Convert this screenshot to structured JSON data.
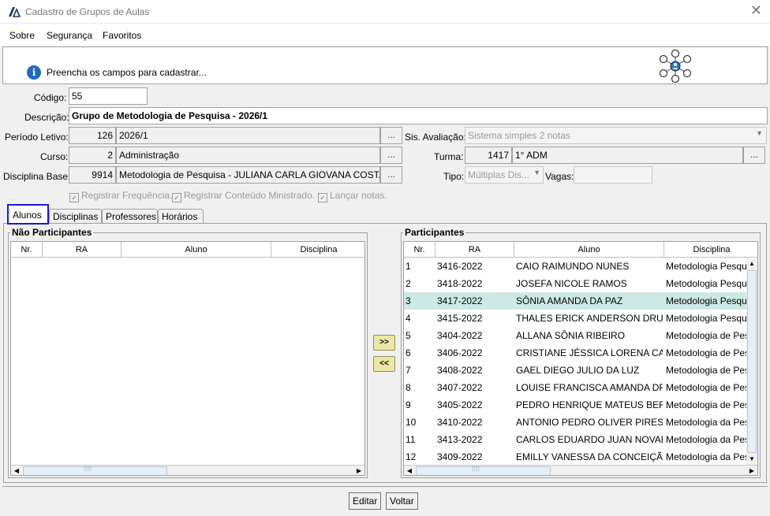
{
  "window": {
    "title": "Cadastro de Grupos de Aulas",
    "close_glyph": "✕"
  },
  "menu": [
    {
      "label": "Sobre"
    },
    {
      "label": "Segurança"
    },
    {
      "label": "Favoritos"
    }
  ],
  "info": {
    "icon_letter": "i",
    "message": "Preencha os campos para cadastrar..."
  },
  "form": {
    "codigo_label": "Código:",
    "codigo_value": "55",
    "descricao_label": "Descrição:",
    "descricao_value": "Grupo de Metodologia de Pesquisa - 2026/1",
    "periodo_label": "Período Letivo:",
    "periodo_code": "126",
    "periodo_value": "2026/1",
    "sis_avaliacao_label": "Sis. Avaliação:",
    "sis_avaliacao_value": "Sistema simples 2 notas",
    "curso_label": "Curso:",
    "curso_code": "2",
    "curso_value": "Administração",
    "turma_label": "Turma:",
    "turma_code": "1417",
    "turma_value": "1° ADM",
    "disciplina_label": "Disciplina Base:",
    "disciplina_code": "9914",
    "disciplina_value": "Metodologia de Pesquisa - JULIANA CARLA GIOVANA COSTA",
    "tipo_label": "Tipo:",
    "tipo_value": "Múltiplas Dis...",
    "vagas_label": "Vagas:",
    "vagas_value": "",
    "ellipsis": "...",
    "check_frequencia": "Registrar Frequência.",
    "check_conteudo": "Registrar Conteúdo Ministrado.",
    "check_notas": "Lançar notas.",
    "check_mark": "✓"
  },
  "tabs": [
    {
      "label": "Alunos"
    },
    {
      "label": "Disciplinas"
    },
    {
      "label": "Professores"
    },
    {
      "label": "Horários"
    }
  ],
  "nao_participantes": {
    "title": "Não Participantes",
    "columns": [
      "Nr.",
      "RA",
      "Aluno",
      "Disciplina"
    ]
  },
  "participantes": {
    "title": "Participantes",
    "columns": [
      "Nr.",
      "RA",
      "Aluno",
      "Disciplina"
    ],
    "rows": [
      {
        "nr": "1",
        "ra": "3416-2022",
        "aluno": "CAIO RAIMUNDO NUNES",
        "disciplina": "Metodologia Pesqu"
      },
      {
        "nr": "2",
        "ra": "3418-2022",
        "aluno": "JOSEFA NICOLE RAMOS",
        "disciplina": "Metodologia Pesqu"
      },
      {
        "nr": "3",
        "ra": "3417-2022",
        "aluno": "SÔNIA AMANDA DA PAZ",
        "disciplina": "Metodologia Pesqu"
      },
      {
        "nr": "4",
        "ra": "3415-2022",
        "aluno": "THALES ERICK ANDERSON DRUM...",
        "disciplina": "Metodologia Pesqu"
      },
      {
        "nr": "5",
        "ra": "3404-2022",
        "aluno": "ALLANA SÔNIA RIBEIRO",
        "disciplina": "Metodologia de Pes"
      },
      {
        "nr": "6",
        "ra": "3406-2022",
        "aluno": "CRISTIANE JÉSSICA LORENA CAM...",
        "disciplina": "Metodologia de Pes"
      },
      {
        "nr": "7",
        "ra": "3408-2022",
        "aluno": "GAEL DIEGO JULIO DA LUZ",
        "disciplina": "Metodologia de Pes"
      },
      {
        "nr": "8",
        "ra": "3407-2022",
        "aluno": "LOUISE FRANCISCA AMANDA DR...",
        "disciplina": "Metodologia de Pes"
      },
      {
        "nr": "9",
        "ra": "3405-2022",
        "aluno": "PEDRO HENRIQUE MATEUS BERN...",
        "disciplina": "Metodologia de Pes"
      },
      {
        "nr": "10",
        "ra": "3410-2022",
        "aluno": "ANTONIO PEDRO OLIVER PIRES",
        "disciplina": "Metodologia da Pes"
      },
      {
        "nr": "11",
        "ra": "3413-2022",
        "aluno": "CARLOS EDUARDO JUAN NOVAES",
        "disciplina": "Metodologia da Pes"
      },
      {
        "nr": "12",
        "ra": "3409-2022",
        "aluno": "EMILLY VANESSA DA CONCEIÇÃO",
        "disciplina": "Metodologia da Pes"
      }
    ]
  },
  "transfer": {
    "add": ">>",
    "remove": "<<"
  },
  "scroll": {
    "left": "◀",
    "right": "▶",
    "up": "▲",
    "down": "▼",
    "grip": "⁞⁞⁞⁞"
  },
  "buttons": {
    "editar": "Editar",
    "voltar": "Voltar"
  },
  "colors": {
    "selected_row": "#cde9e6",
    "active_tab_border": "#1818d8",
    "info_icon": "#1e6ac4",
    "transfer_button": "#ece6a4"
  }
}
